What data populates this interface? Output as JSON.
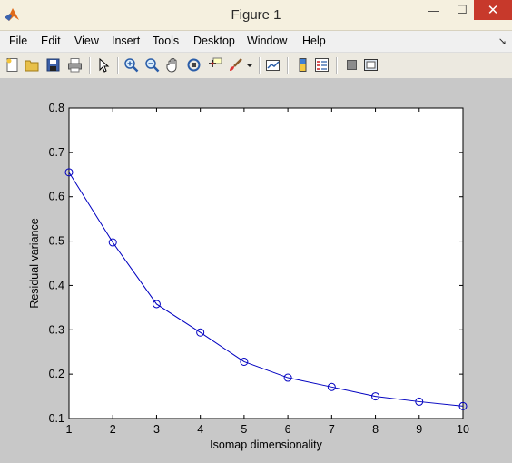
{
  "window": {
    "title": "Figure 1",
    "minimize_glyph": "—",
    "maximize_glyph": "☐",
    "close_glyph": "✕"
  },
  "menubar": {
    "items": [
      "File",
      "Edit",
      "View",
      "Insert",
      "Tools",
      "Desktop",
      "Window",
      "Help"
    ],
    "dock_arrow": "↘"
  },
  "toolbar": {
    "tools": [
      "new-figure-icon",
      "open-file-icon",
      "save-icon",
      "print-icon",
      "edit-plot-icon",
      "zoom-in-icon",
      "zoom-out-icon",
      "pan-icon",
      "rotate-3d-icon",
      "data-cursor-icon",
      "brush-icon",
      "link-plot-icon",
      "insert-colorbar-icon",
      "insert-legend-icon",
      "hide-plot-tools-icon",
      "show-plot-tools-icon"
    ]
  },
  "colors": {
    "axes_background": "#ffffff",
    "figure_background": "#c8c8c8",
    "line": "#0000c0",
    "close_button": "#c7392b"
  },
  "chart_data": {
    "type": "line",
    "title": "",
    "xlabel": "Isomap dimensionality",
    "ylabel": "Residual variance",
    "xlim": [
      1,
      10
    ],
    "ylim": [
      0.1,
      0.8
    ],
    "xticks": [
      "1",
      "2",
      "3",
      "4",
      "5",
      "6",
      "7",
      "8",
      "9",
      "10"
    ],
    "yticks": [
      "0.1",
      "0.2",
      "0.3",
      "0.4",
      "0.5",
      "0.6",
      "0.7",
      "0.8"
    ],
    "grid": false,
    "marker": "circle",
    "series": [
      {
        "x": [
          1,
          2,
          3,
          4,
          5,
          6,
          7,
          8,
          9,
          10
        ],
        "values": [
          0.655,
          0.497,
          0.358,
          0.294,
          0.228,
          0.192,
          0.171,
          0.15,
          0.138,
          0.128
        ]
      }
    ]
  }
}
